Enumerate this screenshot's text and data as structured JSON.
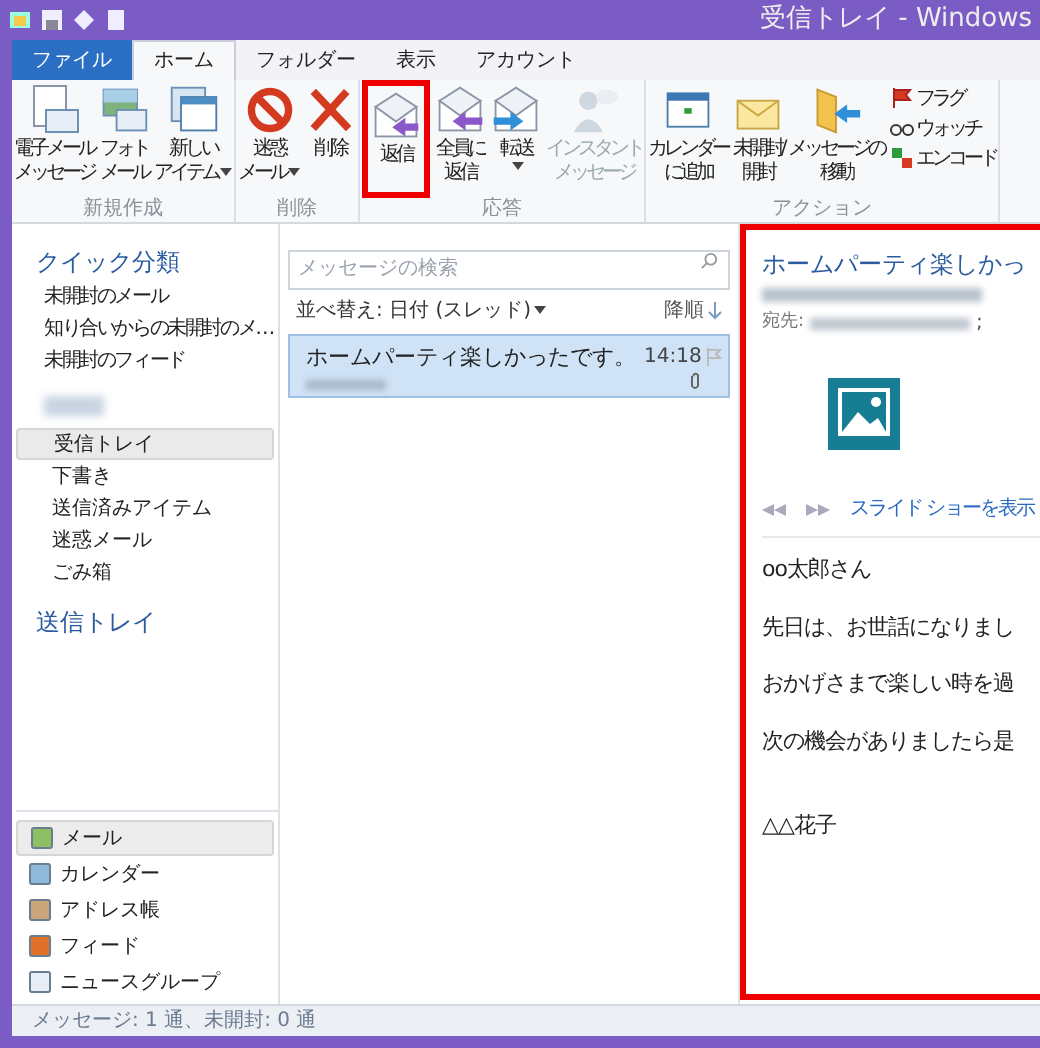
{
  "window": {
    "title": "受信トレイ - Windows"
  },
  "tabs": [
    {
      "label": "ファイル",
      "kind": "file",
      "selected": false
    },
    {
      "label": "ホーム",
      "kind": "tab",
      "selected": true
    },
    {
      "label": "フォルダー",
      "kind": "tab",
      "selected": false
    },
    {
      "label": "表示",
      "kind": "tab",
      "selected": false
    },
    {
      "label": "アカウント",
      "kind": "tab",
      "selected": false
    }
  ],
  "ribbon_groups": [
    {
      "label": "新規作成",
      "buttons": [
        {
          "lines": [
            "電子メール",
            "メッセージ"
          ],
          "dropdown": false,
          "disabled": false,
          "highlighted": false
        },
        {
          "lines": [
            "フォト",
            "メール"
          ],
          "dropdown": false,
          "disabled": false,
          "highlighted": false
        },
        {
          "lines": [
            "新しい",
            "アイテム"
          ],
          "dropdown": true,
          "disabled": false,
          "highlighted": false
        }
      ]
    },
    {
      "label": "削除",
      "buttons": [
        {
          "lines": [
            "迷惑",
            "メール"
          ],
          "dropdown": true,
          "disabled": false,
          "highlighted": false
        },
        {
          "lines": [
            "削除"
          ],
          "dropdown": false,
          "disabled": false,
          "highlighted": false
        }
      ]
    },
    {
      "label": "応答",
      "buttons": [
        {
          "lines": [
            "返信"
          ],
          "dropdown": false,
          "disabled": false,
          "highlighted": true
        },
        {
          "lines": [
            "全員に",
            "返信"
          ],
          "dropdown": false,
          "disabled": false,
          "highlighted": false
        },
        {
          "lines": [
            "転送"
          ],
          "dropdown": true,
          "disabled": false,
          "highlighted": false
        },
        {
          "lines": [
            "インスタント",
            "メッセージ"
          ],
          "dropdown": false,
          "disabled": true,
          "highlighted": false
        }
      ]
    },
    {
      "label": "アクション",
      "buttons": [
        {
          "lines": [
            "カレンダー",
            "に追加"
          ],
          "dropdown": false,
          "disabled": false,
          "highlighted": false
        },
        {
          "lines": [
            "未開封/",
            "開封"
          ],
          "dropdown": false,
          "disabled": false,
          "highlighted": false
        },
        {
          "lines": [
            "メッセージの",
            "移動"
          ],
          "dropdown": false,
          "disabled": false,
          "highlighted": false
        }
      ],
      "small_buttons": [
        {
          "label": "フラグ"
        },
        {
          "label": "ウォッチ"
        },
        {
          "label": "エンコード"
        }
      ]
    }
  ],
  "nav": {
    "quick_heading": "クイック分類",
    "quick_items": [
      {
        "label": "未開封のメール"
      },
      {
        "label": "知り合いからの未開封のメ…"
      },
      {
        "label": "未開封のフィード"
      }
    ],
    "folders": [
      {
        "label": "受信トレイ",
        "selected": true
      },
      {
        "label": "下書き",
        "selected": false
      },
      {
        "label": "送信済みアイテム",
        "selected": false
      },
      {
        "label": "迷惑メール",
        "selected": false
      },
      {
        "label": "ごみ箱",
        "selected": false
      }
    ],
    "outbox_heading": "送信トレイ",
    "modules": [
      {
        "label": "メール",
        "selected": true
      },
      {
        "label": "カレンダー",
        "selected": false
      },
      {
        "label": "アドレス帳",
        "selected": false
      },
      {
        "label": "フィード",
        "selected": false
      },
      {
        "label": "ニュースグループ",
        "selected": false
      }
    ]
  },
  "message_list": {
    "search": {
      "placeholder": "メッセージの検索"
    },
    "sort": "並べ替え: 日付 (スレッド)",
    "order": "降順",
    "messages": [
      {
        "subject": "ホームパーティ楽しかったです。",
        "time": "14:18",
        "selected": true
      }
    ]
  },
  "reading_pane": {
    "highlighted": true,
    "subject": "ホームパーティ楽しかっ",
    "to_label": "宛先:",
    "to_suffix": ";",
    "slideshow": "スライド ショーを表示",
    "body": [
      "oo太郎さん",
      "先日は、お世話になりまし",
      "おかげさまで楽しい時を過",
      "次の機会がありましたら是",
      "△△花子"
    ]
  },
  "status_bar": "メッセージ: 1 通、未開封: 0 通"
}
